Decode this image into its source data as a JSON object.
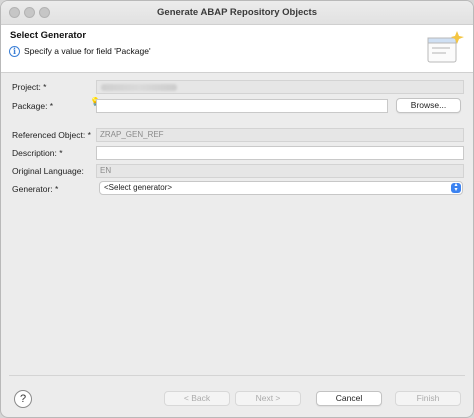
{
  "window": {
    "title": "Generate ABAP Repository Objects"
  },
  "header": {
    "title": "Select Generator",
    "message": "Specify a value for field 'Package'"
  },
  "form": {
    "project_label": "Project: *",
    "package_label": "Package: *",
    "package_value": "",
    "browse_label": "Browse...",
    "referenced_object_label": "Referenced Object: *",
    "referenced_object_value": "ZRAP_GEN_REF",
    "description_label": "Description: *",
    "description_value": "",
    "original_language_label": "Original Language:",
    "original_language_value": "EN",
    "generator_label": "Generator: *",
    "generator_value": "<Select generator>"
  },
  "footer": {
    "help_glyph": "?",
    "back_label": "< Back",
    "next_label": "Next >",
    "cancel_label": "Cancel",
    "finish_label": "Finish"
  }
}
